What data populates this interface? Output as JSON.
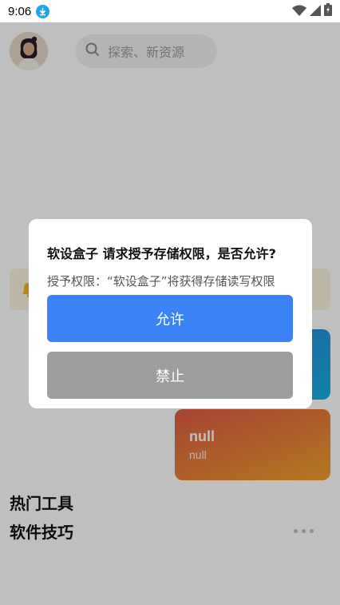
{
  "status_bar": {
    "time": "9:06",
    "icons": [
      "download-icon",
      "wifi-icon",
      "signal-icon",
      "battery-charging-icon"
    ]
  },
  "header": {
    "search_placeholder": "探索、新资源"
  },
  "card": {
    "title": "null",
    "subtitle": "null"
  },
  "sections": {
    "hot_tools": "热门工具",
    "tips": "软件技巧"
  },
  "dialog": {
    "title": "软设盒子 请求授予存储权限，是否允许?",
    "message": "授予权限：“软设盒子”将获得存储读写权限",
    "allow_label": "允许",
    "deny_label": "禁止"
  },
  "colors": {
    "allow_button": "#3b82f6",
    "deny_button": "#9e9e9e",
    "overlay": "rgba(0,0,0,0.25)"
  }
}
